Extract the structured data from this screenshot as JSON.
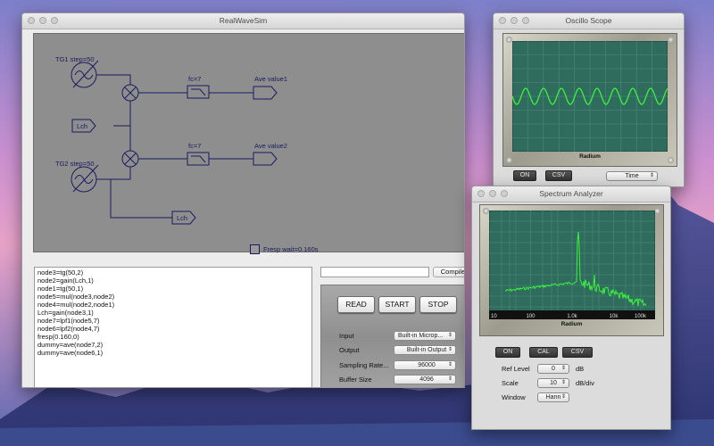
{
  "colors": {
    "canvas_bg": "#8e8e8e",
    "wire": "#1b1b5e",
    "scope_screen": "#2f6c5e",
    "trace": "#3cf23c"
  },
  "main": {
    "title": "RealWaveSim",
    "diagram": {
      "tg1": "TG1 step=50",
      "tg2": "TG2 step=50",
      "lch_top": "Lch",
      "lch_bottom": "Lch",
      "fc1": "fc=7",
      "fc2": "fc=7",
      "ave1": "Ave value1",
      "ave2": "Ave value2",
      "fresp": "Fresp wait=0.160s"
    },
    "script_lines": [
      "node3=tg(50,2)",
      "node2=gain(Lch,1)",
      "node1=tg(50,1)",
      "node5=mul(node3,node2)",
      "node4=mul(node2,node1)",
      "Lch=gain(node3,1)",
      "node7=lpf1(node5,7)",
      "node6=lpf2(node4,7)",
      "fresp(0.160,0)",
      "dummy=ave(node7,2)",
      "dummy=ave(node6,1)"
    ],
    "command_value": "",
    "compile_label": "Compile",
    "controls": {
      "read_label": "READ",
      "start_label": "START",
      "stop_label": "STOP",
      "input_label": "Input",
      "input_value": "Built-in Microp...",
      "output_label": "Output",
      "output_value": "Built-in Output",
      "sampling_label": "Sampling Rate...",
      "sampling_value": "96000",
      "buffer_label": "Buffer Size",
      "buffer_value": "4096"
    }
  },
  "oscilloscope": {
    "title": "Oscillo Scope",
    "brand": "Radium",
    "on_label": "ON",
    "csv_label": "CSV",
    "mode_value": "Time",
    "icons": [
      "screw-icon"
    ]
  },
  "spectrum": {
    "title": "Spectrum Analyzer",
    "brand": "Radium",
    "x_ticks": [
      "10",
      "100",
      "1.0k",
      "10k",
      "100k"
    ],
    "on_label": "ON",
    "cal_label": "CAL",
    "csv_label": "CSV",
    "ref_level_label": "Ref Level",
    "ref_level_value": "0",
    "ref_level_unit": "dB",
    "scale_label": "Scale",
    "scale_value": "10",
    "scale_unit": "dB/div",
    "window_label": "Window",
    "window_value": "Hann"
  }
}
